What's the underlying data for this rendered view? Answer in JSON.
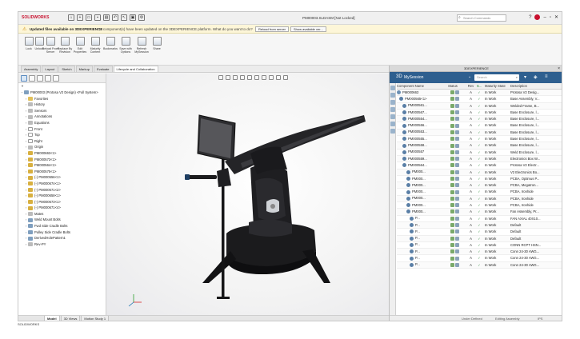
{
  "titlebar": {
    "logo": "SOLIDWORKS",
    "window_title": "PM00003.SLDASM [Not Locked]",
    "search_placeholder": "Search Commands"
  },
  "notification": {
    "title": "Updated files available on 3DEXPERIENCE",
    "message": "11 component(s) have been updated on the 3DEXPERIENCE platform. What do you want to do?",
    "btn_reload": "Reload from server",
    "btn_show": "Show available ver..."
  },
  "commands": [
    {
      "label": "Lock"
    },
    {
      "label": "Unlock"
    },
    {
      "label": "Reload From Server"
    },
    {
      "label": "Replace By Revision"
    },
    {
      "label": "Edit Properties"
    },
    {
      "label": "Maturity Content"
    },
    {
      "label": "Bookmarks"
    },
    {
      "label": "Save with Options"
    },
    {
      "label": "Refresh MySession"
    },
    {
      "label": "Share"
    }
  ],
  "tabs": [
    "Assembly",
    "Layout",
    "Sketch",
    "Markup",
    "Evaluate",
    "Lifecycle and Collaboration"
  ],
  "feature_tree": {
    "filter": "▼",
    "root": "PM00003 (Protosa V2 Design) <Full System>",
    "items": [
      {
        "label": "Favorites",
        "icon": "folder"
      },
      {
        "label": "History",
        "icon": "grey"
      },
      {
        "label": "Sensors",
        "icon": "grey"
      },
      {
        "label": "Annotations",
        "icon": "grey"
      },
      {
        "label": "Equations",
        "icon": "grey"
      },
      {
        "label": "Front",
        "icon": "plane"
      },
      {
        "label": "Top",
        "icon": "plane"
      },
      {
        "label": "Right",
        "icon": "plane"
      },
      {
        "label": "Origin",
        "icon": "grey"
      },
      {
        "label": "PM000663<1>",
        "icon": "part"
      },
      {
        "label": "PM000573<1>",
        "icon": "part"
      },
      {
        "label": "PM000564<1>",
        "icon": "part"
      },
      {
        "label": "PM000575<1>",
        "icon": "part"
      },
      {
        "label": "(-) PM000556<1>",
        "icon": "part"
      },
      {
        "label": "(-) PM000674<1>",
        "icon": "part"
      },
      {
        "label": "(-) PM000671<2>",
        "icon": "part"
      },
      {
        "label": "(-) PM000658<1>",
        "icon": "part"
      },
      {
        "label": "(-) PM000673<1>",
        "icon": "part"
      },
      {
        "label": "(-) PM000671<4>",
        "icon": "part"
      },
      {
        "label": "Mates",
        "icon": "grey"
      },
      {
        "label": "Weld Mount Bolts",
        "icon": "asm"
      },
      {
        "label": "Fwd Side Cradle Bolts",
        "icon": "asm"
      },
      {
        "label": "Pulley Side Cradle Bolts",
        "icon": "asm"
      },
      {
        "label": "DerivedHolePattern1",
        "icon": "asm"
      },
      {
        "label": "Rev-PY",
        "icon": "grey"
      }
    ]
  },
  "bottom_tabs": [
    "Model",
    "3D Views",
    "Motion Study 1"
  ],
  "dx_panel": {
    "header": "3DEXPERIENCE",
    "session": "MySession",
    "search_placeholder": "Search",
    "columns": [
      "Component Name",
      "Status",
      "Rev",
      "Is...",
      "Maturity State",
      "Description"
    ],
    "rows": [
      {
        "name": "PM000663",
        "rev": "A",
        "state": "In Work",
        "desc": "Protosa V2 Desig..."
      },
      {
        "name": "PM000565<1>",
        "rev": "A",
        "state": "In Work",
        "desc": "Base Assembly, V..."
      },
      {
        "name": "PM000561...",
        "rev": "A",
        "state": "In Work",
        "desc": "Welded Frame, B..."
      },
      {
        "name": "PM000567...",
        "rev": "A",
        "state": "In Work",
        "desc": "Base Enclosure, l..."
      },
      {
        "name": "PM000554...",
        "rev": "A",
        "state": "In Work",
        "desc": "Base Enclosure, l..."
      },
      {
        "name": "PM000556...",
        "rev": "A",
        "state": "In Work",
        "desc": "Base Enclosure, l..."
      },
      {
        "name": "PM000553...",
        "rev": "A",
        "state": "In Work",
        "desc": "Base Enclosure, l..."
      },
      {
        "name": "PM000555...",
        "rev": "A",
        "state": "In Work",
        "desc": "Base Enclosure, l..."
      },
      {
        "name": "PM000558...",
        "rev": "A",
        "state": "In Work",
        "desc": "Base Enclosure, l..."
      },
      {
        "name": "PM000557",
        "rev": "A",
        "state": "In Work",
        "desc": "Weld Enclosure, l..."
      },
      {
        "name": "PM000559...",
        "rev": "A",
        "state": "In Work",
        "desc": "Electronics Box W..."
      },
      {
        "name": "PM000564...",
        "rev": "A",
        "state": "In Work",
        "desc": "Protosa V2 Electr..."
      },
      {
        "name": "PM000...",
        "rev": "A",
        "state": "In Work",
        "desc": "V2 Electronics Bo..."
      },
      {
        "name": "PM000...",
        "rev": "A",
        "state": "In Work",
        "desc": "PCBA, Optimus P..."
      },
      {
        "name": "PM000...",
        "rev": "A",
        "state": "In Work",
        "desc": "PCBA, Megatron..."
      },
      {
        "name": "PM000...",
        "rev": "A",
        "state": "In Work",
        "desc": "PCBA, Ironhide"
      },
      {
        "name": "PM000...",
        "rev": "A",
        "state": "In Work",
        "desc": "PCBA, Ironhide"
      },
      {
        "name": "PM000...",
        "rev": "A",
        "state": "In Work",
        "desc": "PCBA, Ironhide"
      },
      {
        "name": "PM000...",
        "rev": "A",
        "state": "In Work",
        "desc": "Fan Assembly, Pr..."
      },
      {
        "name": "P...",
        "rev": "A",
        "state": "In Work",
        "desc": "FAN AXIAL 40X10..."
      },
      {
        "name": "P...",
        "rev": "A",
        "state": "In Work",
        "desc": "Default"
      },
      {
        "name": "P...",
        "rev": "A",
        "state": "In Work",
        "desc": "Default"
      },
      {
        "name": "P...",
        "rev": "A",
        "state": "In Work",
        "desc": "Default"
      },
      {
        "name": "P...",
        "rev": "A",
        "state": "In Work",
        "desc": "CONN RCPT HSN..."
      },
      {
        "name": "P...",
        "rev": "A",
        "state": "In Work",
        "desc": "Conn 24-30 AWG..."
      },
      {
        "name": "P...",
        "rev": "A",
        "state": "In Work",
        "desc": "Conn 24-30 AWG..."
      },
      {
        "name": "P...",
        "rev": "A",
        "state": "In Work",
        "desc": "Conn 24-30 AWG..."
      }
    ],
    "footer_left": "Under Defined",
    "footer_mid": "Editing Assembly",
    "footer_right": "IPS"
  },
  "bottom_status": "SOLIDWORKS",
  "colors": {
    "accent": "#2e5f8f",
    "brand": "#c8102e"
  }
}
